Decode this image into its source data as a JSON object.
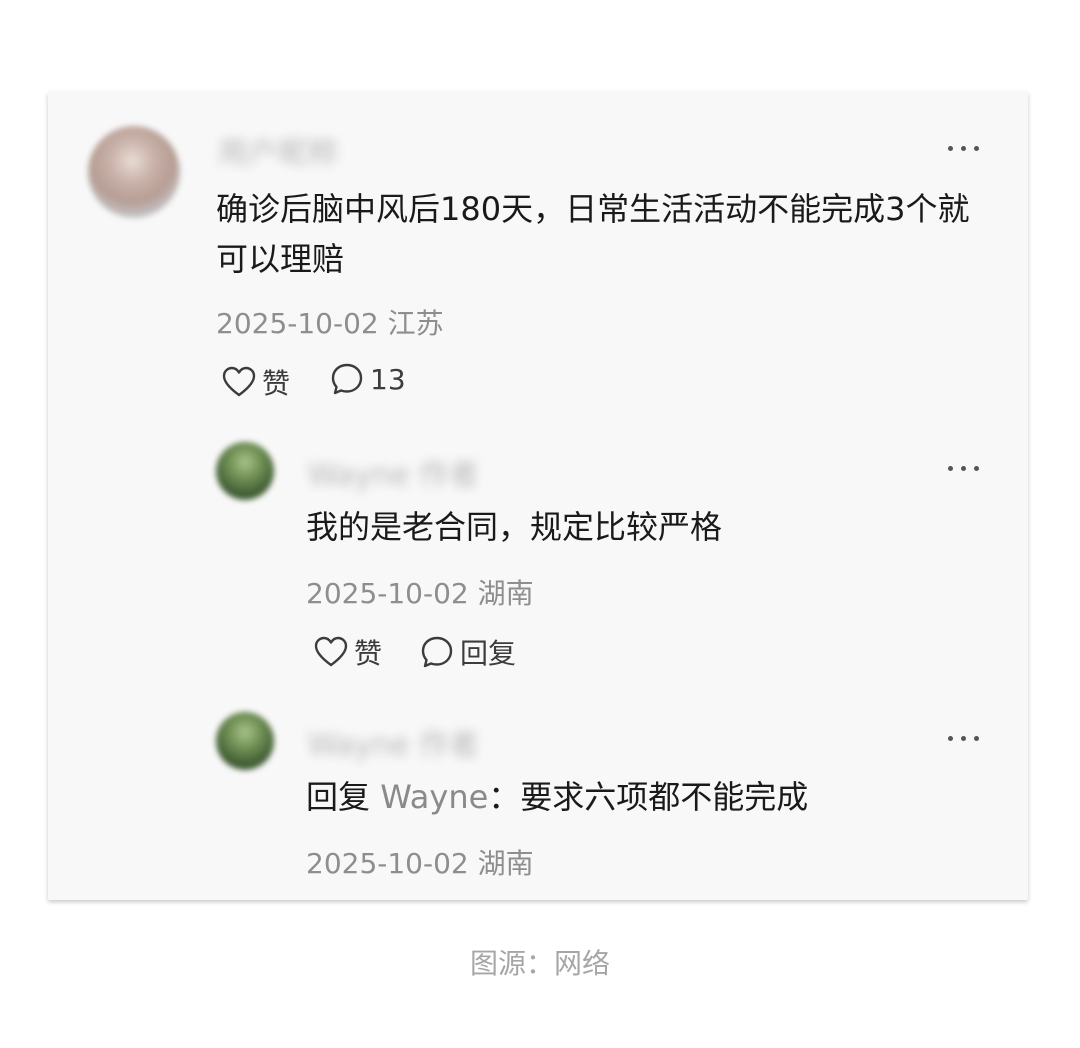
{
  "comments": [
    {
      "username": "用户昵称",
      "content": "确诊后脑中风后180天，日常生活活动不能完成3个就可以理赔",
      "date": "2025-10-02",
      "location": "江苏",
      "like_label": "赞",
      "comment_count": "13"
    }
  ],
  "replies": [
    {
      "username": "Wayne 作者",
      "content": "我的是老合同，规定比较严格",
      "date": "2025-10-02",
      "location": "湖南",
      "like_label": "赞",
      "reply_label": "回复"
    },
    {
      "username": "Wayne 作者",
      "reply_prefix": "回复",
      "reply_to": "Wayne",
      "content": "：要求六项都不能完成",
      "date": "2025-10-02",
      "location": "湖南"
    }
  ],
  "caption": "图源：网络",
  "colors": {
    "card_bg": "#f8f8f8",
    "text": "#1a1a1a",
    "meta": "#8e8e8e"
  },
  "icons": [
    "more-icon",
    "heart-icon",
    "comment-icon"
  ]
}
